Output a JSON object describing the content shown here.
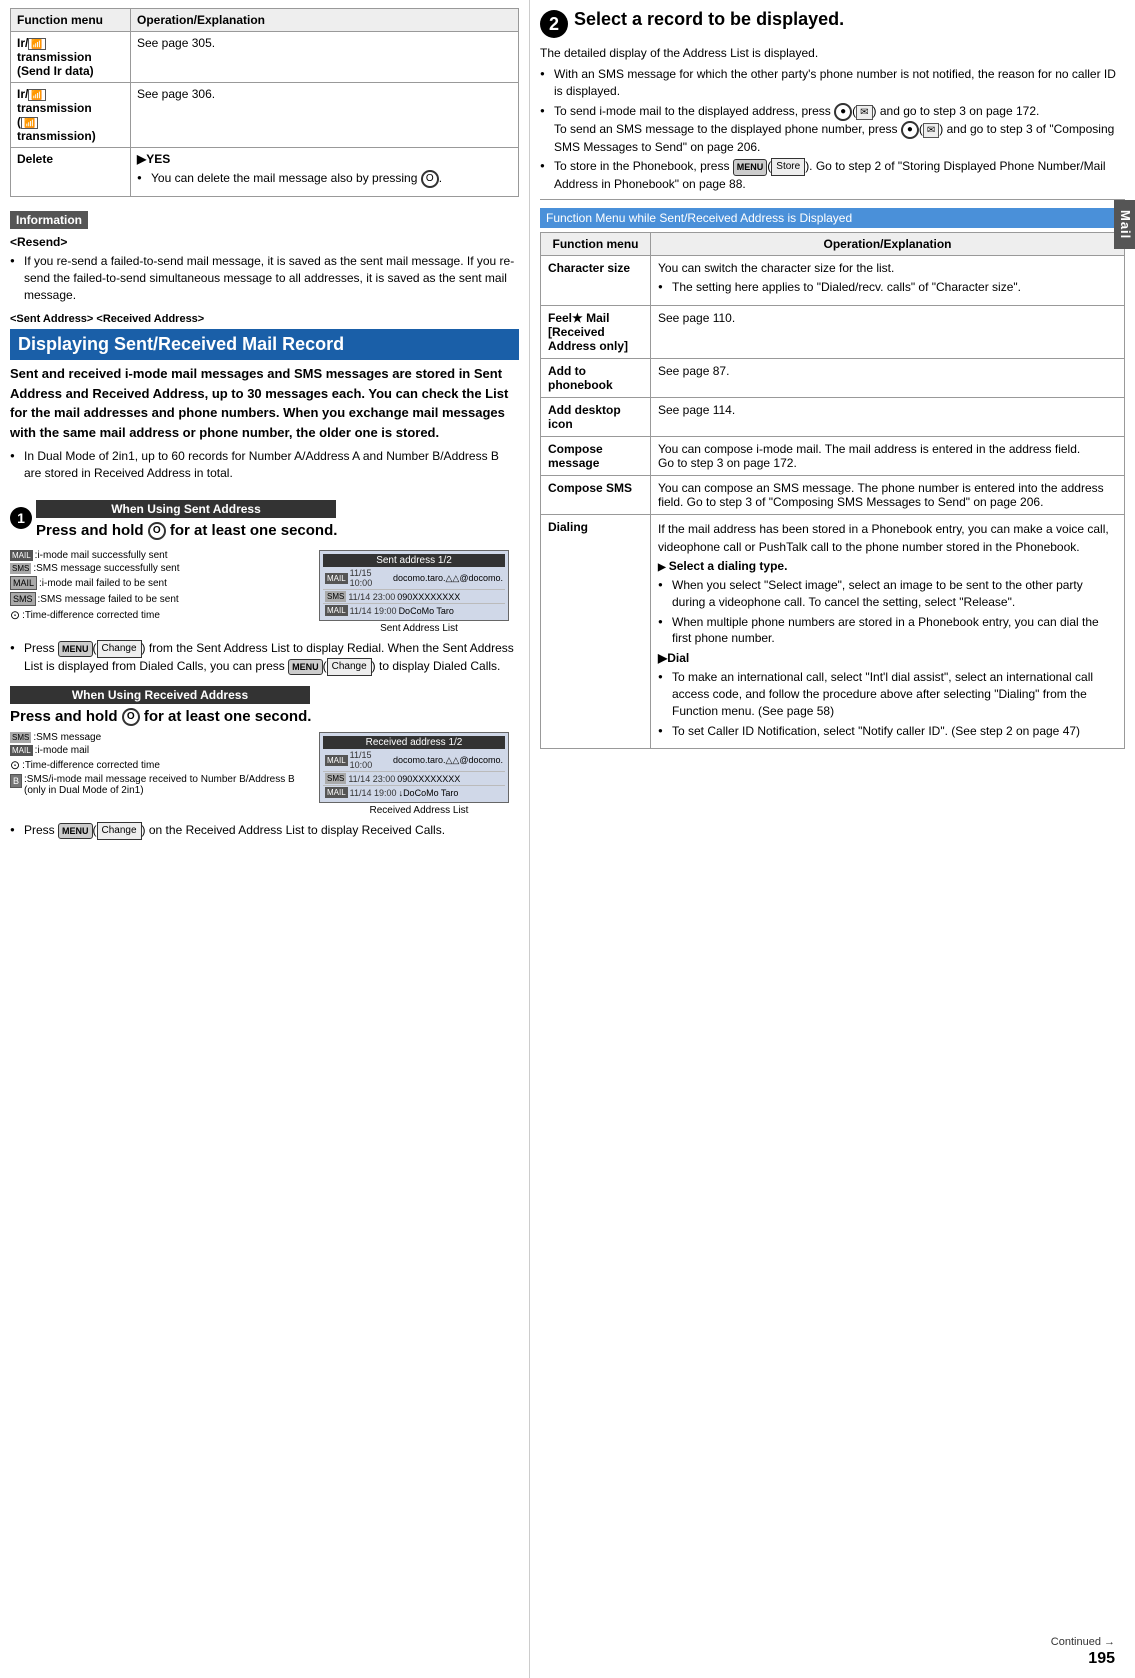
{
  "left": {
    "table1": {
      "headers": [
        "Function menu",
        "Operation/Explanation"
      ],
      "rows": [
        {
          "func": "Ir/  transmission\n(Send Ir data)",
          "op": "See page 305."
        },
        {
          "func": "Ir/  transmission\n(  transmission)",
          "op": "See page 306."
        },
        {
          "func": "Delete",
          "op_arrow": "YES",
          "op_bullet": "You can delete the mail message also by pressing",
          "op_icon": "O"
        }
      ]
    },
    "info_label": "Information",
    "resend_title": "<Resend>",
    "resend_text": "If you re-send a failed-to-send mail message, it is saved as the sent mail message. If you re-send the failed-to-send simultaneous message to all addresses, it is saved as the sent mail message.",
    "sent_received_label": "<Sent Address> <Received Address>",
    "blue_heading": "Displaying Sent/Received Mail Record",
    "intro_bold": "Sent and received i-mode mail messages and SMS messages are stored in Sent Address and Received Address, up to 30 messages each. You can check the List for the mail addresses and phone numbers. When you exchange mail messages with the same mail address or phone number, the older one is stored.",
    "dual_mode_note": "In Dual Mode of 2in1, up to 60 records for Number A/Address A and Number B/Address B are stored in Received Address in total.",
    "step1_when_using": "When Using Sent Address",
    "step1_press": "Press and hold",
    "step1_icon": "O",
    "step1_for": "for at least one second.",
    "screen_sent": {
      "title": "Sent address  1/2",
      "rows": [
        {
          "icon": "MAIL",
          "time": "11/15 10:00",
          "name": "docomo.taro.△△@docomo."
        },
        {
          "icon": "SMS",
          "time": "11/14 23:00",
          "name": "090XXXXXXXX"
        },
        {
          "icon": "MAIL",
          "time": "11/14 19:00",
          "name": "DoCoMo Taro"
        }
      ],
      "label": "Sent Address List"
    },
    "left_icons": [
      {
        "icon": "SMS",
        "desc": ":SMS message successfully sent"
      },
      {
        "icon": "MAIL",
        "desc": ":i-mode mail successfully sent"
      },
      {
        "icon": "SMS",
        "desc": ":SMS message failed to be sent"
      },
      {
        "icon": "MAIL",
        "desc": ":i-mode mail failed to be sent"
      },
      {
        "icon": "TIME",
        "desc": ":Time-difference corrected time"
      }
    ],
    "sent_bullet": "Press  (  ) from the Sent Address List to display Redial. When the Sent Address List is displayed from Dialed Calls, you can press  (  ) to display Dialed Calls.",
    "sent_menu_label": "MENU",
    "sent_change_label": "Change",
    "step2_when_using": "When Using Received Address",
    "step2_press": "Press and hold",
    "step2_icon": "O",
    "step2_for": "for at least one second.",
    "screen_recv": {
      "title": "Received address 1/2",
      "rows": [
        {
          "icon": "MAIL",
          "time": "11/15 10:00",
          "name": "docomo.taro.△△@docomo."
        },
        {
          "icon": "SMS",
          "time": "11/14 23:00",
          "name": "090XXXXXXXX"
        },
        {
          "icon": "MAIL",
          "time": "11/14 19:00",
          "name": "↓DoCoMo Taro"
        }
      ],
      "label": "Received Address List"
    },
    "recv_icons": [
      {
        "icon": "SMS",
        "desc": ":SMS message"
      },
      {
        "icon": "MAIL",
        "desc": ":i-mode mail"
      },
      {
        "icon": "TIME",
        "desc": ":Time-difference corrected time"
      },
      {
        "icon": "NUMG",
        "desc": ":SMS/i-mode mail message received to Number B/Address B (only in Dual Mode of 2in1)"
      }
    ],
    "recv_bullet": "Press  (  ) on the Received Address List to display Received Calls."
  },
  "right": {
    "step2_title": "Select a record to be displayed.",
    "step2_desc": "The detailed display of the Address List is displayed.",
    "bullets": [
      "With an SMS message for which the other party's phone number is not notified, the reason for no caller ID is displayed.",
      "To send i-mode mail to the displayed address, press",
      "To send an SMS message to the displayed phone number, press",
      "To store in the Phonebook, press",
      "To store in step 2 of \"Storing Displayed Phone Number/Mail Address in Phonebook\" on page 88."
    ],
    "imode_mail_icon": "●",
    "imode_mail_text": "and go to step 3 on page 172.",
    "sms_text": "and go to step 3 of \"Composing SMS Messages to Send\" on page 206.",
    "store_text": ". Go to step 2 of \"Storing Displayed Phone Number/Mail Address in Phonebook\" on page 88.",
    "func_menu_heading": "Function Menu while Sent/Received Address is Displayed",
    "func_table": {
      "headers": [
        "Function menu",
        "Operation/Explanation"
      ],
      "rows": [
        {
          "name": "Character size",
          "desc": "You can switch the character size for the list.",
          "bullet": "The setting here applies to \"Dialed/recv. calls\" of \"Character size\"."
        },
        {
          "name": "Feel★ Mail\n[Received Address only]",
          "desc": "See page 110."
        },
        {
          "name": "Add to phonebook",
          "desc": "See page 87."
        },
        {
          "name": "Add desktop icon",
          "desc": "See page 114."
        },
        {
          "name": "Compose message",
          "desc": "You can compose i-mode mail. The mail address is entered in the address field.\nGo to step 3 on page 172."
        },
        {
          "name": "Compose SMS",
          "desc": "You can compose an SMS message. The phone number is entered into the address field. Go to step 3 of \"Composing SMS Messages to Send\" on page 206."
        },
        {
          "name": "Dialing",
          "desc": "If the mail address has been stored in a Phonebook entry, you can make a voice call, videophone call or PushTalk call to the phone number stored in the Phonebook.",
          "arrow": "Select a dialing type.",
          "sub_bullets": [
            "When you select \"Select image\", select an image to be sent to the other party during a videophone call. To cancel the setting, select \"Release\".",
            "When multiple phone numbers are stored in a Phonebook entry, you can dial the first phone number."
          ],
          "arrow2": "Dial",
          "sub_bullets2": [
            "To make an international call, select \"Int'l dial assist\", select an international call access code, and follow the procedure above after selecting \"Dialing\" from the Function menu. (See page 58)",
            "To set Caller ID Notification, select \"Notify caller ID\". (See step 2 on page 47)"
          ]
        }
      ]
    },
    "mail_tab": "Mail",
    "page_num": "195",
    "continued": "Continued"
  }
}
